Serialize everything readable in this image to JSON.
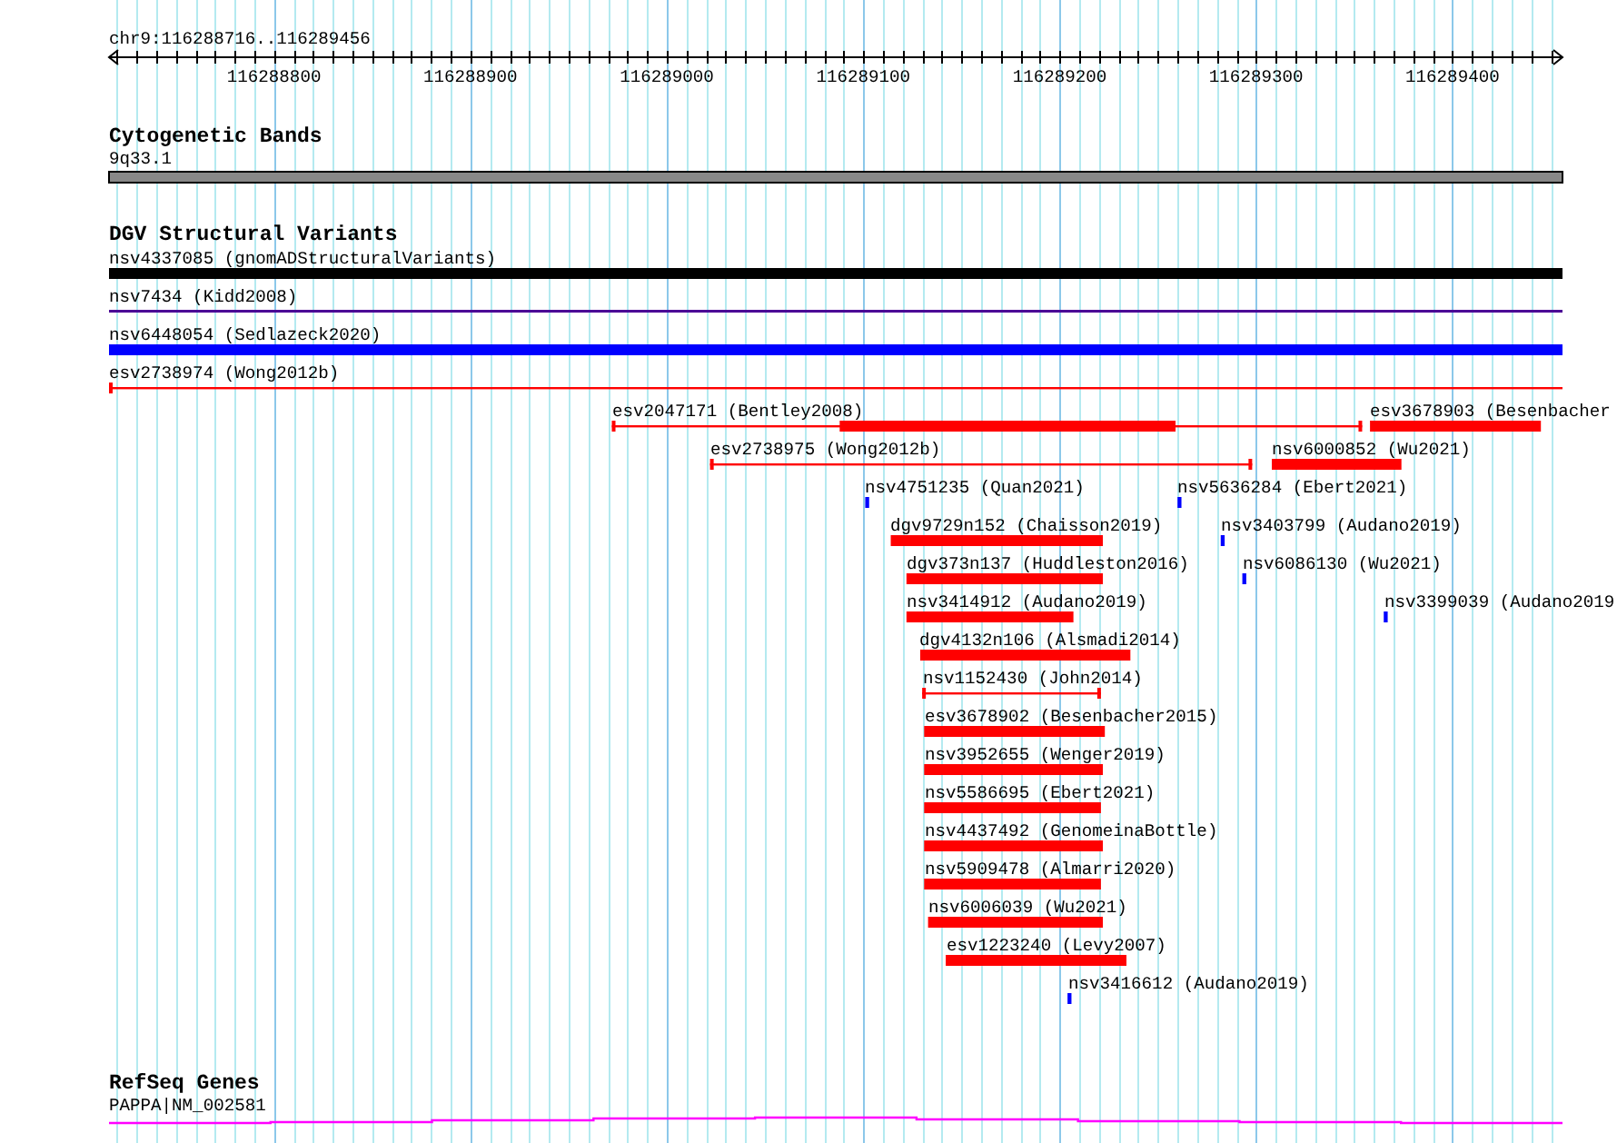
{
  "ruler": {
    "location": "chr9:116288716..116289456",
    "ticks": [
      "116288800",
      "116288900",
      "116289000",
      "116289100",
      "116289200",
      "116289300",
      "116289400"
    ]
  },
  "tracks": [
    {
      "kind": "bands",
      "title": "Cytogenetic Bands",
      "features": [
        {
          "label": "9q33.1",
          "color": "#888888"
        }
      ]
    },
    {
      "kind": "variants",
      "title": "DGV Structural Variants",
      "lanes": [
        [
          {
            "label": "nsv4337085 (gnomADStructuralVariants)",
            "kind": "block",
            "color": "#000000"
          }
        ],
        [
          {
            "label": "nsv7434 (Kidd2008)",
            "kind": "line",
            "color": "#4b0096"
          }
        ],
        [
          {
            "label": "nsv6448054 (Sedlazeck2020)",
            "kind": "block",
            "color": "#0000ff"
          }
        ],
        [
          {
            "label": "esv2738974 (Wong2012b)",
            "kind": "span",
            "color": "#ff0000"
          }
        ],
        [
          {
            "label": "esv2047171 (Bentley2008)",
            "kind": "span",
            "color": "#ff0000"
          },
          {
            "label": "esv3678903 (Besenbacher",
            "kind": "block",
            "color": "#ff0000"
          }
        ],
        [
          {
            "label": "esv2738975 (Wong2012b)",
            "kind": "span",
            "color": "#ff0000"
          },
          {
            "label": "nsv6000852 (Wu2021)",
            "kind": "block",
            "color": "#ff0000"
          }
        ],
        [
          {
            "label": "nsv4751235 (Quan2021)",
            "kind": "point",
            "color": "#0000ff"
          },
          {
            "label": "nsv5636284 (Ebert2021)",
            "kind": "point",
            "color": "#0000ff"
          }
        ],
        [
          {
            "label": "dgv9729n152 (Chaisson2019)",
            "kind": "block",
            "color": "#ff0000"
          },
          {
            "label": "nsv3403799 (Audano2019)",
            "kind": "point",
            "color": "#0000ff"
          }
        ],
        [
          {
            "label": "dgv373n137 (Huddleston2016)",
            "kind": "block",
            "color": "#ff0000"
          },
          {
            "label": "nsv6086130 (Wu2021)",
            "kind": "point",
            "color": "#0000ff"
          }
        ],
        [
          {
            "label": "nsv3414912 (Audano2019)",
            "kind": "block",
            "color": "#ff0000"
          },
          {
            "label": "nsv3399039 (Audano2019",
            "kind": "point",
            "color": "#0000ff"
          }
        ],
        [
          {
            "label": "dgv4132n106 (Alsmadi2014)",
            "kind": "block",
            "color": "#ff0000"
          }
        ],
        [
          {
            "label": "nsv1152430 (John2014)",
            "kind": "span",
            "color": "#ff0000"
          }
        ],
        [
          {
            "label": "esv3678902 (Besenbacher2015)",
            "kind": "block",
            "color": "#ff0000"
          }
        ],
        [
          {
            "label": "nsv3952655 (Wenger2019)",
            "kind": "block",
            "color": "#ff0000"
          }
        ],
        [
          {
            "label": "nsv5586695 (Ebert2021)",
            "kind": "block",
            "color": "#ff0000"
          }
        ],
        [
          {
            "label": "nsv4437492 (GenomeinaBottle)",
            "kind": "block",
            "color": "#ff0000"
          }
        ],
        [
          {
            "label": "nsv5909478 (Almarri2020)",
            "kind": "block",
            "color": "#ff0000"
          }
        ],
        [
          {
            "label": "nsv6006039 (Wu2021)",
            "kind": "block",
            "color": "#ff0000"
          }
        ],
        [
          {
            "label": "esv1223240 (Levy2007)",
            "kind": "block",
            "color": "#ff0000"
          }
        ],
        [
          {
            "label": "nsv3416612 (Audano2019)",
            "kind": "point",
            "color": "#0000ff"
          }
        ]
      ]
    },
    {
      "kind": "genes",
      "title": "RefSeq Genes",
      "features": [
        {
          "label": "PAPPA|NM_002581",
          "color": "#ff00ff"
        }
      ]
    }
  ]
}
